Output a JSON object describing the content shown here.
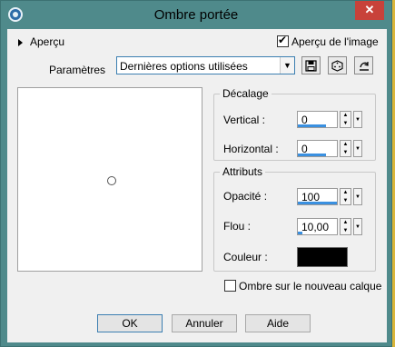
{
  "window": {
    "title": "Ombre portée",
    "close_glyph": "✕"
  },
  "preview_toggle": {
    "label": "Aperçu"
  },
  "preview_on_image": {
    "label": "Aperçu de l'image",
    "checked": true
  },
  "params": {
    "label": "Paramètres",
    "preset": "Dernières options utilisées"
  },
  "toolbar": {
    "save_icon": "floppy-icon",
    "random_icon": "dice-icon",
    "reset_icon": "reset-icon"
  },
  "offset": {
    "legend": "Décalage",
    "vertical_label": "Vertical :",
    "vertical_value": "0",
    "horizontal_label": "Horizontal :",
    "horizontal_value": "0"
  },
  "attributes": {
    "legend": "Attributs",
    "opacity_label": "Opacité :",
    "opacity_value": "100",
    "blur_label": "Flou :",
    "blur_value": "10,00",
    "color_label": "Couleur :",
    "color_value": "#000000"
  },
  "shadow_new_layer": {
    "label": "Ombre sur le nouveau calque",
    "checked": false
  },
  "buttons": {
    "ok": "OK",
    "cancel": "Annuler",
    "help": "Aide"
  }
}
